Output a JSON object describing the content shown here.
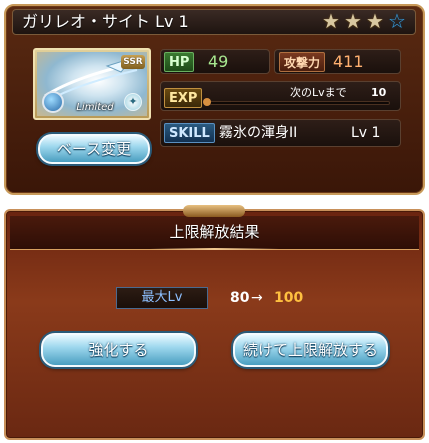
{
  "character": {
    "name_level": "ガリレオ・サイト Lv 1",
    "stars": [
      "filled",
      "filled",
      "filled",
      "empty"
    ],
    "rarity_badge": "SSR",
    "limited_label": "Limited",
    "base_change_label": "ベース変更"
  },
  "stats": {
    "hp_label": "HP",
    "hp_value": "49",
    "atk_label": "攻撃力",
    "atk_value": "411",
    "exp_label": "EXP",
    "exp_next_label": "次のLvまで",
    "exp_next_value": "10",
    "exp_progress": 0.0,
    "skill_label": "SKILL",
    "skill_name": "霧氷の渾身II",
    "skill_level": "Lv 1"
  },
  "dialog": {
    "title": "上限解放結果",
    "max_lv_label": "最大Lv",
    "lv_from": "80",
    "lv_arrow": "→",
    "lv_to": "100",
    "enhance_button": "強化する",
    "continue_button": "続けて上限解放する"
  },
  "colors": {
    "card_bg": "#4a1e0c",
    "dialog_bg": "#7a2e14",
    "button_blue": "#9fd8ee",
    "lv_to": "#ffc040",
    "star_empty": "#3aa0e0"
  }
}
